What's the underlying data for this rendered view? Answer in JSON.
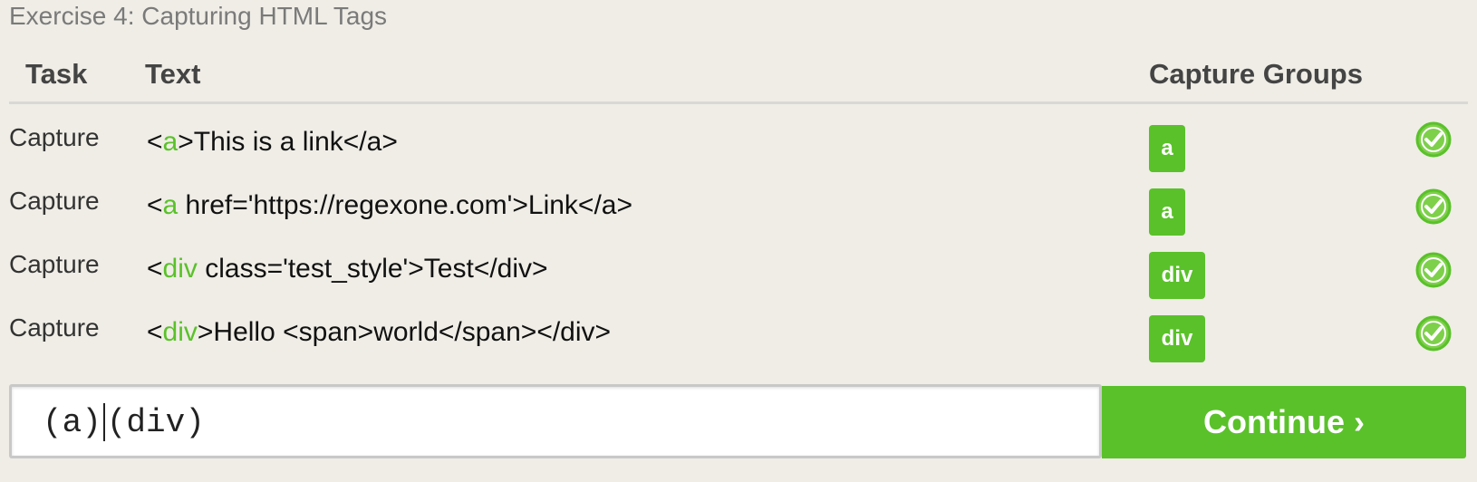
{
  "exercise_title": "Exercise 4: Capturing HTML Tags",
  "headers": {
    "task": "Task",
    "text": "Text",
    "capture_groups": "Capture Groups"
  },
  "rows": [
    {
      "task": "Capture",
      "tag": "a",
      "rest": ">This is a link</a>",
      "group": "a",
      "status": "matched"
    },
    {
      "task": "Capture",
      "tag": "a",
      "rest": " href='https://regexone.com'>Link</a>",
      "group": "a",
      "status": "matched"
    },
    {
      "task": "Capture",
      "tag": "div",
      "rest": " class='test_style'>Test</div>",
      "group": "div",
      "status": "matched"
    },
    {
      "task": "Capture",
      "tag": "div",
      "rest": ">Hello <span>world</span></div>",
      "group": "div",
      "status": "matched"
    }
  ],
  "input": {
    "before_cursor": "(a)",
    "after_cursor": "(div)"
  },
  "continue_label": "Continue ›",
  "colors": {
    "accent": "#5ac12a",
    "background": "#efede6"
  },
  "icons": {
    "status": "check-circle-icon"
  }
}
